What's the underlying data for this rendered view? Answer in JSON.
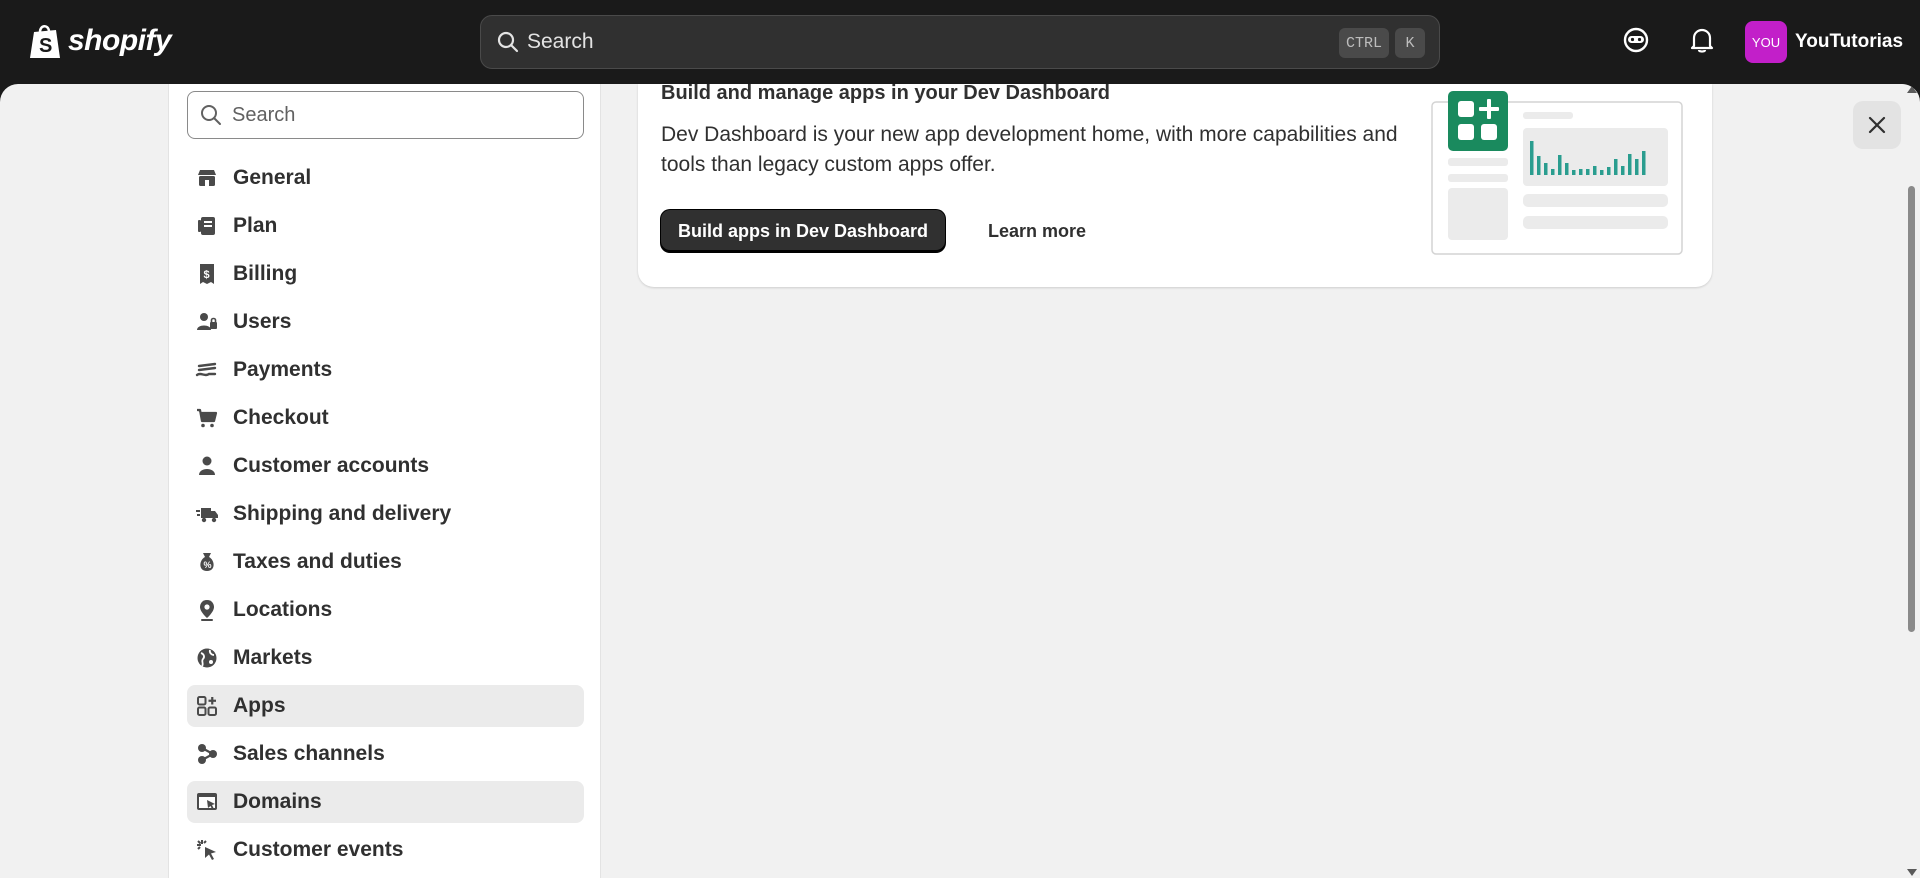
{
  "topbar": {
    "logo_text": "shopify",
    "search_label": "Search",
    "shortcut_ctrl": "CTRL",
    "shortcut_k": "K",
    "account": {
      "avatar_text": "YOU",
      "name": "YouTutorias",
      "avatar_color": "#c21fc9"
    }
  },
  "sidebar": {
    "search_placeholder": "Search",
    "items": [
      {
        "label": "General",
        "icon": "store-icon"
      },
      {
        "label": "Plan",
        "icon": "plan-icon"
      },
      {
        "label": "Billing",
        "icon": "receipt-icon"
      },
      {
        "label": "Users",
        "icon": "users-icon"
      },
      {
        "label": "Payments",
        "icon": "payments-icon"
      },
      {
        "label": "Checkout",
        "icon": "cart-icon"
      },
      {
        "label": "Customer accounts",
        "icon": "person-icon"
      },
      {
        "label": "Shipping and delivery",
        "icon": "truck-icon"
      },
      {
        "label": "Taxes and duties",
        "icon": "tax-bag-icon"
      },
      {
        "label": "Locations",
        "icon": "location-pin-icon"
      },
      {
        "label": "Markets",
        "icon": "globe-icon"
      },
      {
        "label": "Apps",
        "icon": "apps-icon",
        "active": true
      },
      {
        "label": "Sales channels",
        "icon": "channels-icon"
      },
      {
        "label": "Domains",
        "icon": "domains-icon",
        "hover": true
      },
      {
        "label": "Customer events",
        "icon": "cursor-click-icon"
      }
    ]
  },
  "card": {
    "title": "Build and manage apps in your Dev Dashboard",
    "description": "Dev Dashboard is your new app development home, with more capabilities and tools than legacy custom apps offer.",
    "primary_button": "Build apps in Dev Dashboard",
    "link_button": "Learn more",
    "accent_color": "#1a8a5e"
  }
}
